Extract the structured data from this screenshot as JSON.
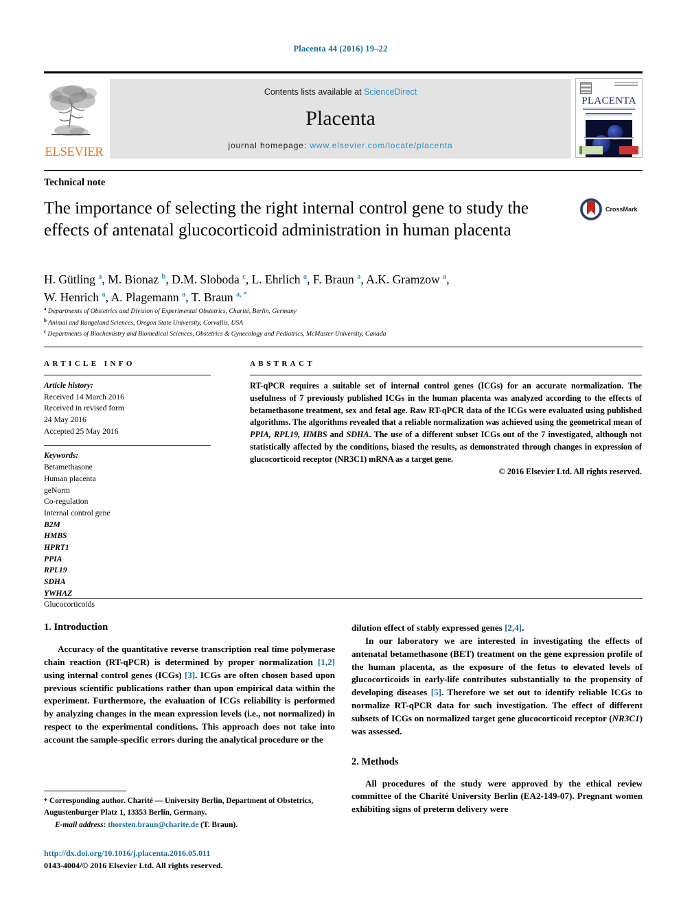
{
  "running_head": "Placenta 44 (2016) 19–22",
  "masthead": {
    "publisher": "ELSEVIER",
    "contents_prefix": "Contents lists available at",
    "contents_link": "ScienceDirect",
    "journal_name": "Placenta",
    "homepage_prefix": "journal homepage:",
    "homepage_url": "www.elsevier.com/locate/placenta",
    "cover_title": "PLACENTA"
  },
  "article": {
    "type": "Technical note",
    "title": "The importance of selecting the right internal control gene to study the effects of antenatal glucocorticoid administration in human placenta",
    "crossmark_label": "CrossMark",
    "authors_line_1_parts": [
      {
        "name": "H. Gütling",
        "sup": "a"
      },
      {
        "name": "M. Bionaz",
        "sup": "b"
      },
      {
        "name": "D.M. Sloboda",
        "sup": "c"
      },
      {
        "name": "L. Ehrlich",
        "sup": "a"
      },
      {
        "name": "F. Braun",
        "sup": "a"
      },
      {
        "name": "A.K. Gramzow",
        "sup": "a"
      }
    ],
    "authors_line_2_parts": [
      {
        "name": "W. Henrich",
        "sup": "a"
      },
      {
        "name": "A. Plagemann",
        "sup": "a"
      },
      {
        "name": "T. Braun",
        "sup": "a, *"
      }
    ],
    "affiliations": [
      {
        "marker": "a",
        "text": "Departments of Obstetrics and Division of Experimental Obstetrics, Charité, Berlin, Germany"
      },
      {
        "marker": "b",
        "text": "Animal and Rangeland Sciences, Oregon State University, Corvallis, USA"
      },
      {
        "marker": "c",
        "text": "Departments of Biochemistry and Biomedical Sciences, Obstetrics & Gynecology and Pediatrics, McMaster University, Canada"
      }
    ]
  },
  "info": {
    "label": "ARTICLE INFO",
    "history_head": "Article history:",
    "history": [
      "Received 14 March 2016",
      "Received in revised form",
      "24 May 2016",
      "Accepted 25 May 2016"
    ],
    "keywords_head": "Keywords:",
    "keywords": [
      {
        "text": "Betamethasone",
        "italic": false
      },
      {
        "text": "Human placenta",
        "italic": false
      },
      {
        "text": "geNorm",
        "italic": false
      },
      {
        "text": "Co-regulation",
        "italic": false
      },
      {
        "text": "Internal control gene",
        "italic": false
      },
      {
        "text": "B2M",
        "italic": true
      },
      {
        "text": "HMBS",
        "italic": true
      },
      {
        "text": "HPRT1",
        "italic": true
      },
      {
        "text": "PPIA",
        "italic": true
      },
      {
        "text": "RPL19",
        "italic": true
      },
      {
        "text": "SDHA",
        "italic": true
      },
      {
        "text": "YWHAZ",
        "italic": true
      },
      {
        "text": "Glucocorticoids",
        "italic": false
      }
    ]
  },
  "abstract": {
    "label": "ABSTRACT",
    "text_part_1": "RT-qPCR requires a suitable set of internal control genes (ICGs) for an accurate normalization. The usefulness of 7 previously published ICGs in the human placenta was analyzed according to the effects of betamethasone treatment, sex and fetal age. Raw RT-qPCR data of the ICGs were evaluated using published algorithms. The algorithms revealed that a reliable normalization was achieved using the geometrical mean of ",
    "genes_italic": "PPIA, RPL19, HMBS",
    "text_part_2": " and ",
    "genes_italic_2": "SDHA",
    "text_part_3": ". The use of a different subset ICGs out of the 7 investigated, although not statistically affected by the conditions, biased the results, as demonstrated through changes in expression of glucocorticoid receptor (NR3C1) mRNA as a target gene.",
    "copyright": "© 2016 Elsevier Ltd. All rights reserved."
  },
  "body": {
    "intro_heading": "1. Introduction",
    "intro_p1_a": "Accuracy of the quantitative reverse transcription real time polymerase chain reaction (RT-qPCR) is determined by proper normalization ",
    "intro_p1_cite1": "[1,2]",
    "intro_p1_b": " using internal control genes (ICGs) ",
    "intro_p1_cite2": "[3]",
    "intro_p1_c": ". ICGs are often chosen based upon previous scientific publications rather than upon empirical data within the experiment. Furthermore, the evaluation of ICGs reliability is performed by analyzing changes in the mean expression levels (i.e., not normalized) in respect to the experimental conditions. This approach does not take into account the sample-specific errors during the analytical procedure or the dilution effect of stably expressed genes ",
    "intro_p1_cite3": "[2,4]",
    "intro_p1_d": ".",
    "intro_p2_a": "In our laboratory we are interested in investigating the effects of antenatal betamethasone (BET) treatment on the gene expression profile of the human placenta, as the exposure of the fetus to elevated levels of glucocorticoids in early-life contributes substantially to the propensity of developing diseases ",
    "intro_p2_cite": "[5]",
    "intro_p2_b": ". Therefore we set out to identify reliable ICGs to normalize RT-qPCR data for such investigation. The effect of different subsets of ICGs on normalized target gene glucocorticoid receptor (",
    "intro_p2_gene": "NR3C1",
    "intro_p2_c": ") was assessed.",
    "methods_heading": "2. Methods",
    "methods_p1": "All procedures of the study were approved by the ethical review committee of the Charité University Berlin (EA2-149-07). Pregnant women exhibiting signs of preterm delivery were"
  },
  "footer": {
    "corresponding_star": "*",
    "corresponding_text": " Corresponding author. Charité — University Berlin, Department of Obstetrics, Augustenburger Platz 1, 13353 Berlin, Germany.",
    "email_label": "E-mail address:",
    "email": "thorsten.braun@charite.de",
    "email_suffix": " (T. Braun).",
    "doi": "http://dx.doi.org/10.1016/j.placenta.2016.05.011",
    "issn_line": "0143-4004/© 2016 Elsevier Ltd. All rights reserved."
  },
  "colors": {
    "link_blue": "#2e8fc0",
    "header_blue": "#1a6b9a",
    "elsevier_orange": "#e87722",
    "masthead_gray": "#e3e3e3"
  }
}
